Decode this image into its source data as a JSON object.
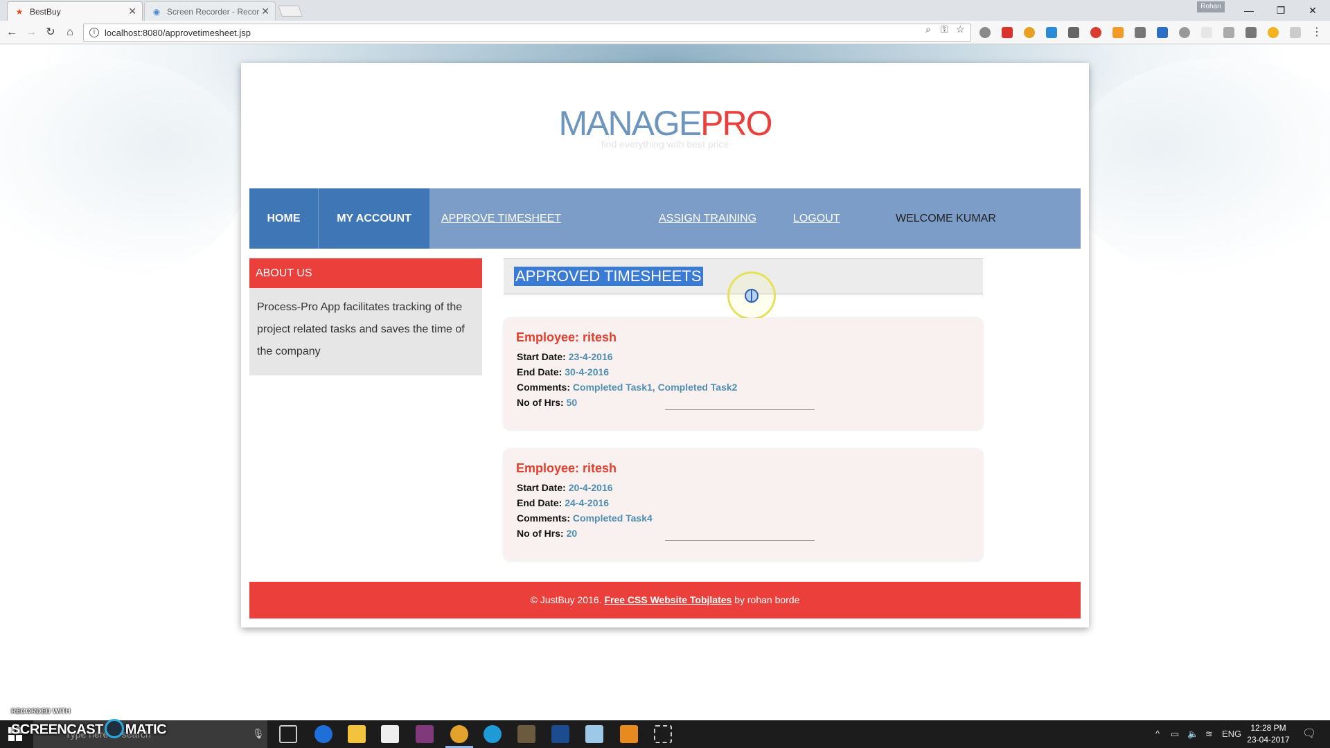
{
  "browser": {
    "tabs": [
      {
        "title": "BestBuy",
        "active": true
      },
      {
        "title": "Screen Recorder - Recor",
        "active": false
      }
    ],
    "profile_name": "Rohan",
    "url": "localhost:8080/approvetimesheet.jsp",
    "icons": [
      "back-icon",
      "forward-icon",
      "reload-icon",
      "home-icon",
      "info-icon",
      "zoom-icon",
      "key-icon",
      "star-icon",
      "menu-icon"
    ]
  },
  "page": {
    "logo": {
      "part1": "MANAGE",
      "part2": "PRO"
    },
    "tagline": "find everything with best price",
    "nav": {
      "home": "HOME",
      "my_account": "MY ACCOUNT",
      "approve_timesheet": "APPROVE TIMESHEET",
      "assign_training": "ASSIGN TRAINING",
      "logout": "LOGOUT",
      "welcome": "WELCOME KUMAR"
    },
    "about": {
      "title": "ABOUT US",
      "text": "Process-Pro App facilitates tracking of the project related tasks and saves the time of the company"
    },
    "section_title": "APPROVED TIMESHEETS",
    "labels": {
      "start": "Start Date:",
      "end": "End Date:",
      "comments": "Comments:",
      "hours": "No of Hrs:"
    },
    "timesheets": [
      {
        "employee": "Employee: ritesh",
        "start": "23-4-2016",
        "end": "30-4-2016",
        "comments": "Completed Task1, Completed Task2",
        "hours": "50"
      },
      {
        "employee": "Employee: ritesh",
        "start": "20-4-2016",
        "end": "24-4-2016",
        "comments": "Completed Task4",
        "hours": "20"
      }
    ],
    "footer": {
      "prefix": "© JustBuy 2016. ",
      "link": "Free CSS Website Tobjlates",
      "suffix": " by rohan borde"
    },
    "colors": {
      "nav_bg": "#7b9dc7",
      "nav_active": "#3f76b6",
      "accent_red": "#ea3f3a",
      "value_blue": "#4f8db2"
    }
  },
  "watermark": {
    "label": "RECORDED WITH",
    "brand_left": "SCREENCAST",
    "brand_right": "MATIC"
  },
  "taskbar": {
    "search_placeholder": "Type here to search",
    "language": "ENG",
    "time": "12:28 PM",
    "date": "23-04-2017"
  }
}
